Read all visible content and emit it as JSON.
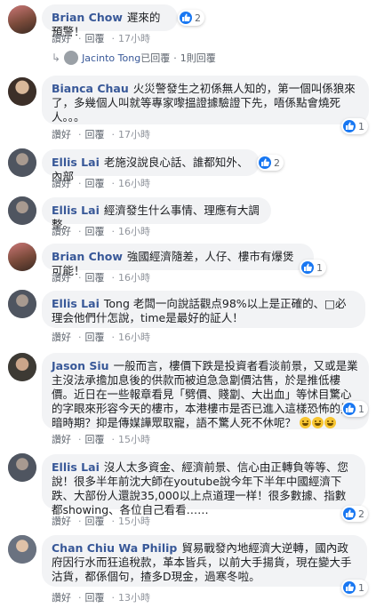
{
  "colors": {
    "author": "#385898",
    "bubble": "#f2f3f5",
    "like": "#1877f2"
  },
  "labels": {
    "like": "讚好",
    "reply": "回覆"
  },
  "comments": [
    {
      "author": "Brian Chow",
      "text": "遲來的預警！",
      "time": "17小時",
      "reactions": "2",
      "avatar_color": "#7a4a3a"
    },
    {
      "author": "Bianca Chau",
      "text": "火災警發生之初係無人知的，第一個叫係狼來了，多幾個人叫就等專家嚟搵證據驗證下先，唔係點會燒死人。。。",
      "time": "17小時",
      "reactions": "1",
      "avatar_color": "#5a5246"
    },
    {
      "author": "Ellis Lai",
      "text": "老施沒說良心話、誰都知外、內部",
      "time": "16小時",
      "reactions": "2",
      "avatar_color": "#4f5560"
    },
    {
      "author": "Ellis Lai",
      "text": "經濟發生什么事情、理應有大調整。",
      "time": "16小時",
      "reactions": "",
      "avatar_color": "#4f5560"
    },
    {
      "author": "Brian Chow",
      "text": "強國經濟隨差，人仔、樓市有爆煲可能！",
      "time": "16小時",
      "reactions": "1",
      "avatar_color": "#7a4a3a"
    },
    {
      "author": "Ellis Lai",
      "text": "Tong 老闆一向說話觀点98%以上是正確的、□必理会他們什怎說，time是最好的証人！",
      "time": "16小時",
      "reactions": "",
      "avatar_color": "#4f5560"
    },
    {
      "author": "Jason Siu",
      "text": "一般而言，樓價下跌是投資者看淡前景，又或是業主沒法承擔加息後的供款而被迫急急劏價沽售，於是推低樓價。近日在一些報章看見「劈價、賤劏、大出血」等怵目驚心的字眼來形容今天的樓市，本港樓市是否已進入這樣恐怖的黑暗時期？抑是傳媒譁眾取寵，語不驚人死不休呢？",
      "time": "15小時",
      "reactions": "1",
      "avatar_color": "#3d3a34"
    },
    {
      "author": "Ellis Lai",
      "text": "沒人太多資金、經濟前景、信心由正轉負等等、您說！很多半年前沈大師在youtube說今年下半年中國經濟下跌、大部份人還說35,000以上点道理一样！很多數據、指數都showing、各位自己看看……",
      "time": "15小時",
      "reactions": "2",
      "avatar_color": "#4f5560"
    },
    {
      "author": "Chan Chiu Wa Philip",
      "text": "貿易戰發內地經濟大逆轉，國內政府因行水而狂追稅款，革本皆兵，以前大手揚貨，現在變大手沽貨，都係個句，揸多D現金，過寒冬啦。",
      "time": "13小時",
      "reactions": "1",
      "avatar_color": "#6a7280"
    }
  ],
  "reply_thread": {
    "name": "Jacinto Tong",
    "suffix": "已回覆",
    "count": "1則回覆"
  }
}
